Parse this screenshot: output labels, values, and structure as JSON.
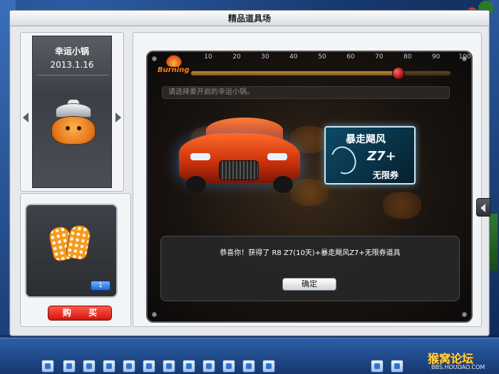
{
  "window": {
    "title": "精品道具场"
  },
  "item_panel": {
    "name": "幸运小锅",
    "date": "2013.1.16"
  },
  "reward_panel": {
    "count_badge": "1",
    "buy_label": "购 买"
  },
  "progress": {
    "burning_label": "Burning",
    "ticks": [
      "10",
      "20",
      "30",
      "40",
      "50",
      "60",
      "70",
      "80",
      "90",
      "100"
    ],
    "value_percent": 80
  },
  "hint_text": "请选择要开启的幸运小锅。",
  "voucher": {
    "title": "暴走飓风",
    "code": "Z7+",
    "subtitle": "无限券"
  },
  "dialog": {
    "message": "恭喜你！获得了 R8 Z7(10天)+暴走飓风Z7+无限券道具",
    "ok_label": "确定"
  },
  "watermark": {
    "text": "猴窝论坛",
    "url": "BBS.HOUDAO.COM"
  },
  "icons": [
    "left-arrow-icon",
    "right-arrow-icon",
    "pot-icon",
    "mitten-icon",
    "flame-icon",
    "car-icon",
    "side-tab-arrow-icon"
  ]
}
